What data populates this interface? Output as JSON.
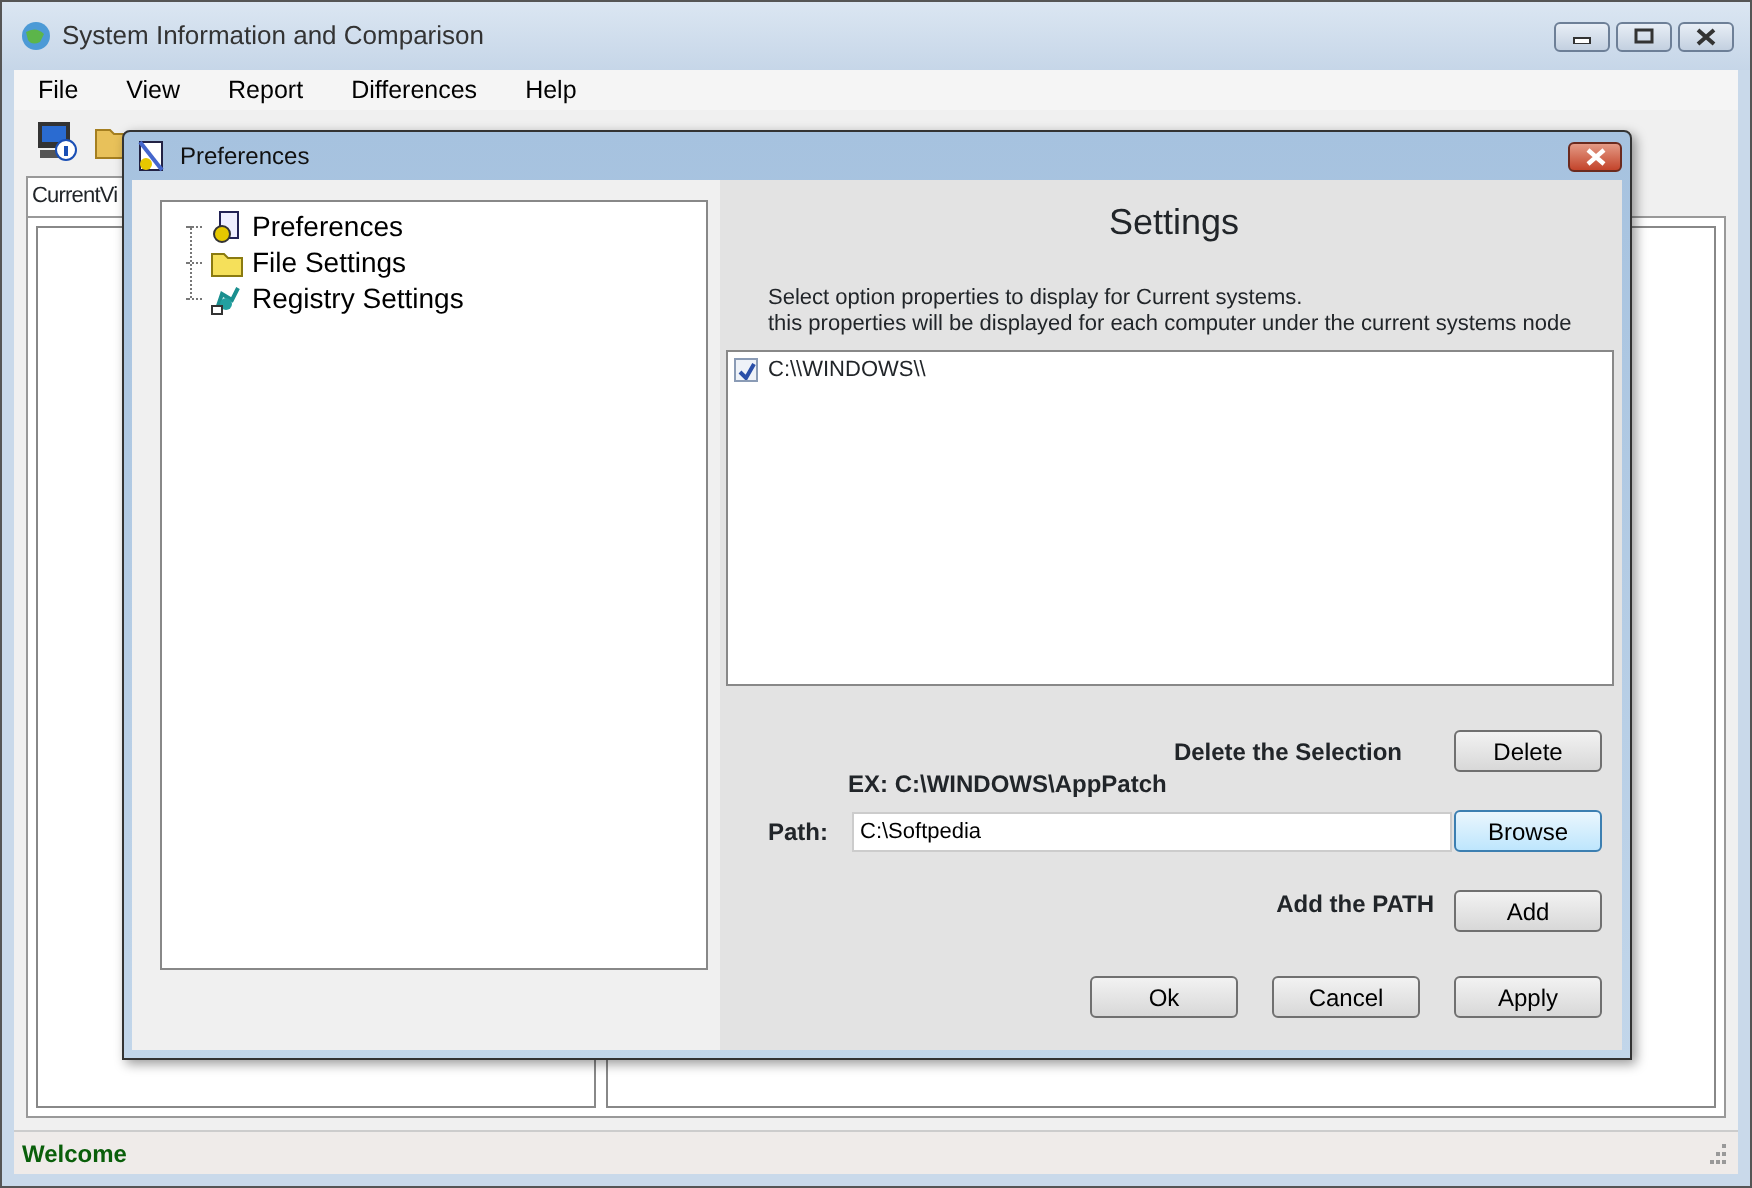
{
  "window": {
    "title": "System Information and Comparison"
  },
  "menu": [
    "File",
    "View",
    "Report",
    "Differences",
    "Help"
  ],
  "tab": {
    "label": "CurrentVi"
  },
  "status_bar": "Welcome",
  "dialog": {
    "title": "Preferences",
    "tree": [
      {
        "label": "Preferences",
        "kind": "prefs"
      },
      {
        "label": "File Settings",
        "kind": "folder"
      },
      {
        "label": "Registry Settings",
        "kind": "registry"
      }
    ],
    "heading": "Settings",
    "description": [
      "Select option properties to display for Current systems.",
      "this properties will be displayed for each computer under the current systems node"
    ],
    "paths": [
      {
        "label": "C:\\\\WINDOWS\\\\",
        "checked": true
      }
    ],
    "delete_label": "Delete the Selection",
    "delete_button": "Delete",
    "example": "EX:  C:\\WINDOWS\\AppPatch",
    "path_label": "Path:",
    "path_value": "C:\\Softpedia",
    "browse_button": "Browse",
    "add_label": "Add the PATH",
    "add_button": "Add",
    "footer_buttons": [
      "Ok",
      "Cancel",
      "Apply"
    ]
  }
}
